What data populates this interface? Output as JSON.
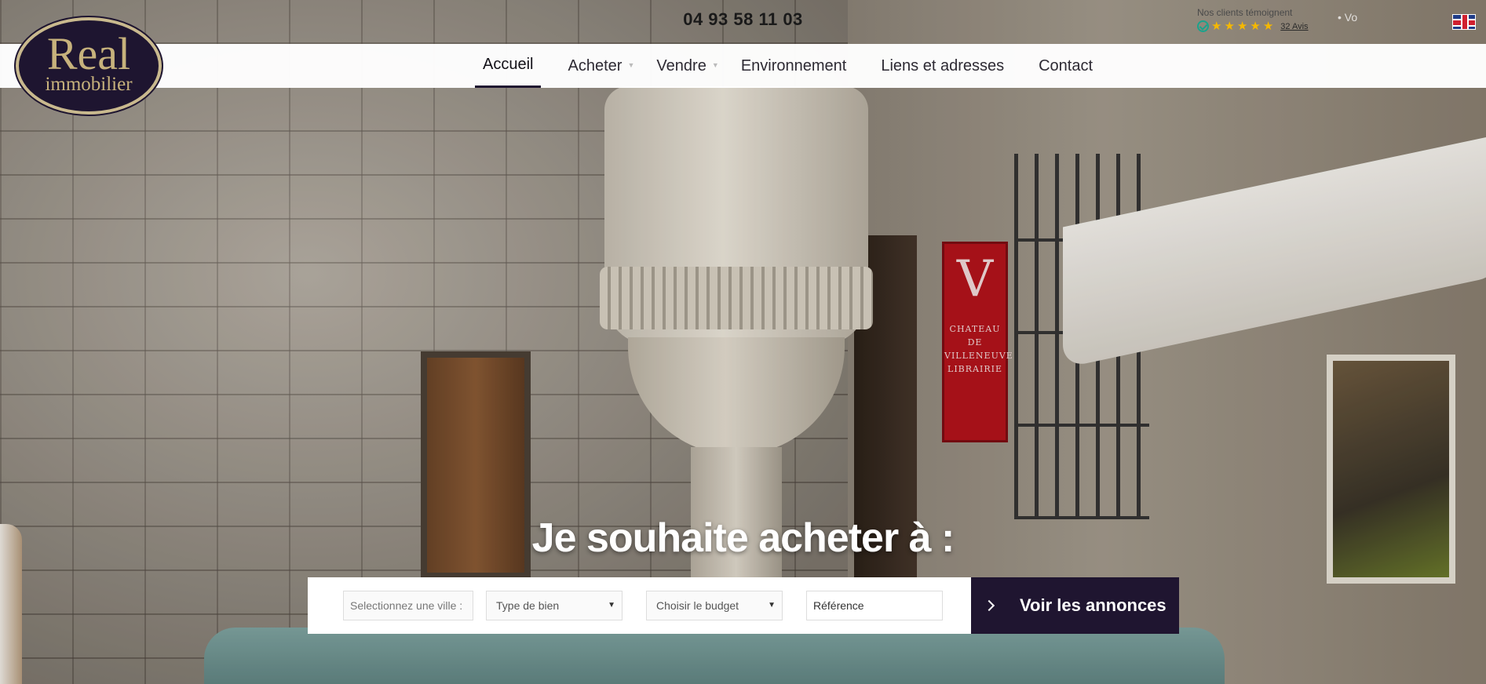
{
  "topbar": {
    "phone": "04 93 58 11 03",
    "reviews_label": "Nos clients témoignent",
    "reviews_count": "32 Avis",
    "lang_ghost": "• Vo",
    "language_flag": "uk-flag-icon"
  },
  "logo": {
    "main": "Real",
    "sub": "immobilier"
  },
  "nav": {
    "items": [
      {
        "label": "Accueil"
      },
      {
        "label": "Acheter"
      },
      {
        "label": "Vendre"
      },
      {
        "label": "Environnement"
      },
      {
        "label": "Liens et adresses"
      },
      {
        "label": "Contact"
      }
    ],
    "active": "Accueil"
  },
  "sign": {
    "letter": "V",
    "text1": "CHATEAU",
    "text2": "DE VILLENEUVE",
    "text3": "LIBRAIRIE"
  },
  "hero": {
    "title": "Je souhaite acheter à :",
    "city_placeholder": "Selectionnez une ville :",
    "type_value": "Type de bien",
    "budget_value": "Choisir le budget",
    "reference_placeholder": "Référence",
    "submit_label": "Voir les annonces"
  },
  "colors": {
    "brand": "#1f1530",
    "gold": "#c7b27c",
    "star": "#f5b800",
    "check": "#1aa38c"
  }
}
